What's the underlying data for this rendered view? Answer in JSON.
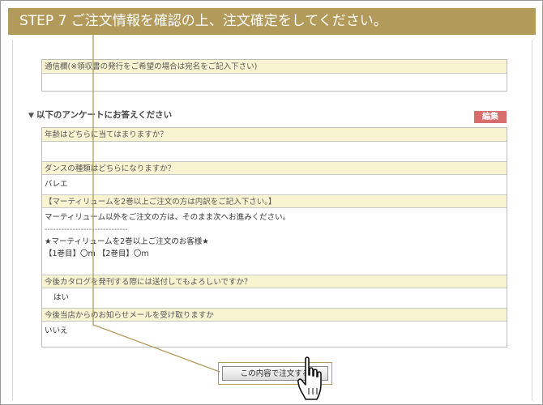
{
  "banner": {
    "text": "STEP 7  ご注文情報を確認の上、注文確定をしてください。"
  },
  "remarks": {
    "label": "通信欄(※領収書の発行をご希望の場合は宛名をご記入下さい)",
    "value": ""
  },
  "survey": {
    "heading": "以下のアンケートにお答えください",
    "edit_label": "編集",
    "q1": {
      "label": "年齢はどちらに当てはまりますか？",
      "value": ""
    },
    "q2": {
      "label": "ダンスの種類はどちらになりますか？",
      "value": "バレエ"
    },
    "q3": {
      "label": "【マーティリュームを2巻以上ご注文の方は内訳をご記入下さい。】",
      "lines": [
        "マーティリューム以外をご注文の方は、そのまま次へお進みください。",
        "------------------------------",
        "★マーティリュームを2巻以上ご注文のお客様★",
        "【1巻目】〇m 【2巻目】〇m"
      ]
    },
    "q4": {
      "label": "今後カタログを発刊する際には送付してもよろしいですか？",
      "value": "はい"
    },
    "q5": {
      "label": "今後当店からのお知らせメールを受け取りますか",
      "value": "いいえ"
    }
  },
  "confirm": {
    "label": "この内容で注文する"
  },
  "colors": {
    "banner": "#b29a5a",
    "label_bg": "#f8f4d2",
    "edit": "#d86d6d"
  }
}
